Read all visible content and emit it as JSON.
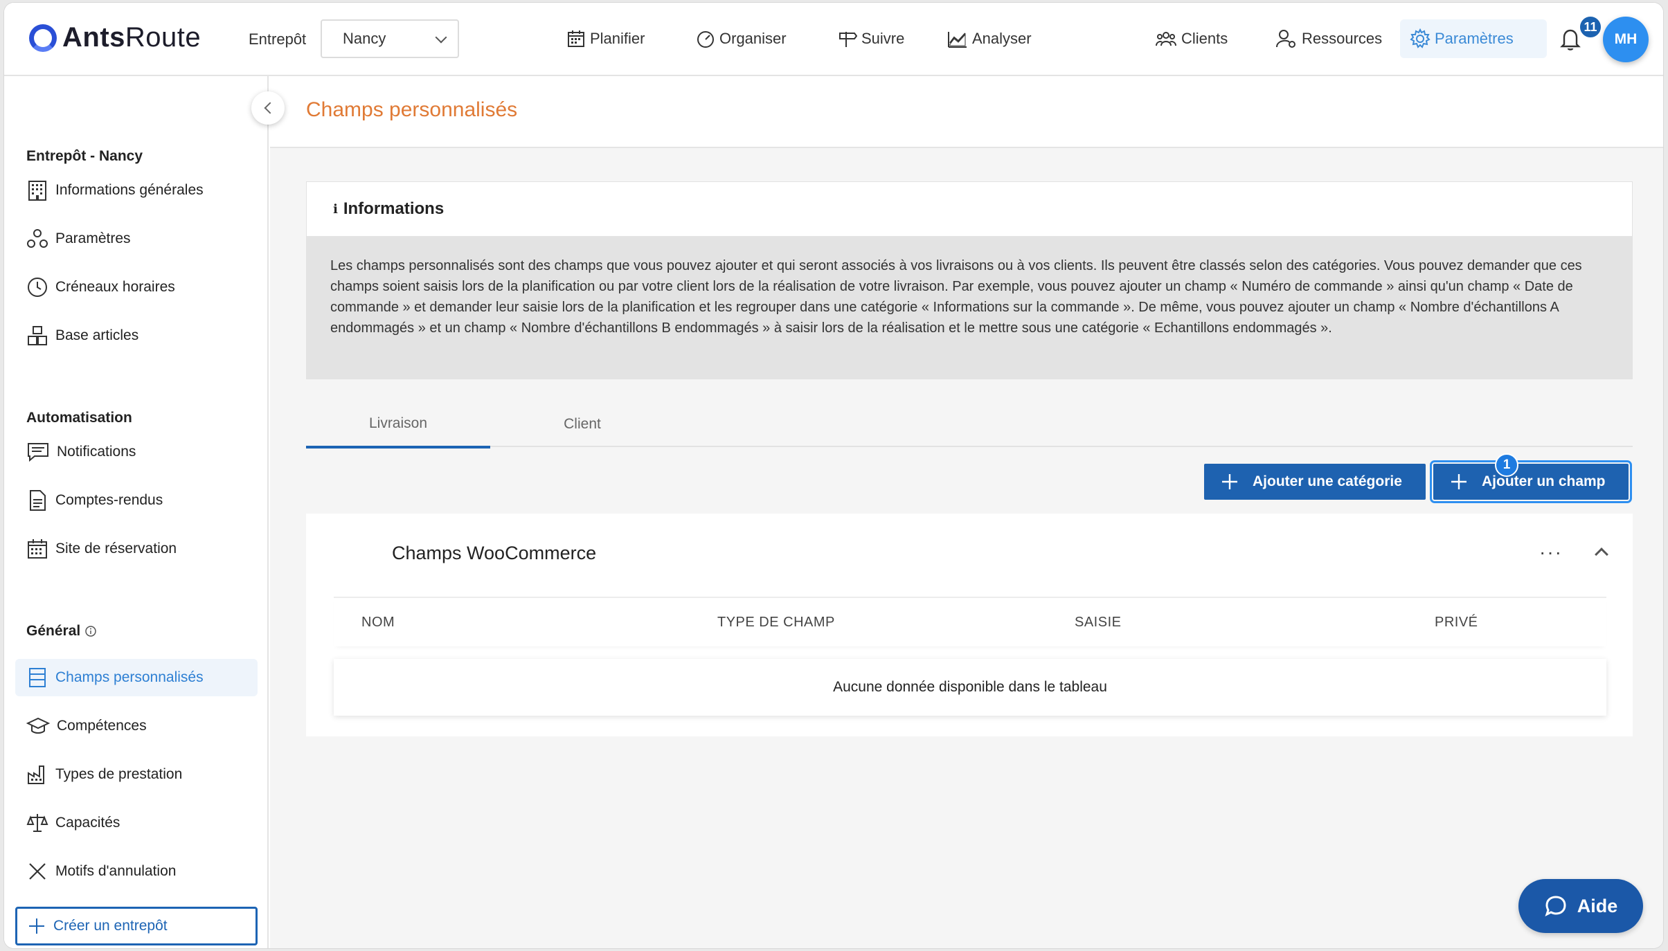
{
  "brand": {
    "name_bold": "Ants",
    "name_rest": "Route"
  },
  "header": {
    "warehouse_label": "Entrepôt",
    "warehouse_value": "Nancy",
    "nav": [
      {
        "label": "Planifier",
        "icon": "calendar-icon"
      },
      {
        "label": "Organiser",
        "icon": "gauge-icon"
      },
      {
        "label": "Suivre",
        "icon": "signpost-icon"
      },
      {
        "label": "Analyser",
        "icon": "chart-icon"
      },
      {
        "label": "Clients",
        "icon": "users-icon"
      },
      {
        "label": "Ressources",
        "icon": "user-gear-icon"
      },
      {
        "label": "Paramètres",
        "icon": "gear-icon"
      }
    ],
    "notification_count": "11",
    "avatar_initials": "MH"
  },
  "sidebar": {
    "section1_title": "Entrepôt - Nancy",
    "section1_items": [
      {
        "label": "Informations générales",
        "icon": "building-icon"
      },
      {
        "label": "Paramètres",
        "icon": "nodes-icon"
      },
      {
        "label": "Créneaux horaires",
        "icon": "clock-icon"
      },
      {
        "label": "Base articles",
        "icon": "boxes-icon"
      }
    ],
    "section2_title": "Automatisation",
    "section2_items": [
      {
        "label": "Notifications",
        "icon": "message-icon"
      },
      {
        "label": "Comptes-rendus",
        "icon": "document-icon"
      },
      {
        "label": "Site de réservation",
        "icon": "calendar-icon"
      }
    ],
    "section3_title": "Général",
    "section3_items": [
      {
        "label": "Champs personnalisés",
        "icon": "list-icon"
      },
      {
        "label": "Compétences",
        "icon": "graduation-cap-icon"
      },
      {
        "label": "Types de prestation",
        "icon": "factory-icon"
      },
      {
        "label": "Capacités",
        "icon": "scale-icon"
      },
      {
        "label": "Motifs d'annulation",
        "icon": "x-icon"
      }
    ],
    "create_label": "Créer un entrepôt"
  },
  "main": {
    "page_title": "Champs personnalisés",
    "info_title": "Informations",
    "info_text": "Les champs personnalisés sont des champs que vous pouvez ajouter et qui seront associés à vos livraisons ou à vos clients. Ils peuvent être classés selon des catégories. Vous pouvez demander que ces champs soient saisis lors de la planification ou par votre client lors de la réalisation de votre livraison. Par exemple, vous pouvez ajouter un champ « Numéro de commande » ainsi qu'un champ « Date de commande » et demander leur saisie lors de la planification et les regrouper dans une catégorie « Informations sur la commande ». De même, vous pouvez ajouter un champ « Nombre d'échantillons A endommagés » et un champ « Nombre d'échantillons B endommagés » à saisir lors de la réalisation et le mettre sous une catégorie « Echantillons endommagés ».",
    "tabs": [
      {
        "label": "Livraison"
      },
      {
        "label": "Client"
      }
    ],
    "add_category_label": "Ajouter une catégorie",
    "add_field_label": "Ajouter un champ",
    "step_badge": "1",
    "category": {
      "title": "Champs WooCommerce",
      "columns": [
        "NOM",
        "TYPE DE CHAMP",
        "SAISIE",
        "PRIVÉ"
      ],
      "empty_text": "Aucune donnée disponible dans le tableau"
    },
    "help_label": "Aide"
  },
  "colors": {
    "accent": "#1e62b0",
    "title_orange": "#e07a35",
    "active_blue": "#2d7fd3"
  }
}
